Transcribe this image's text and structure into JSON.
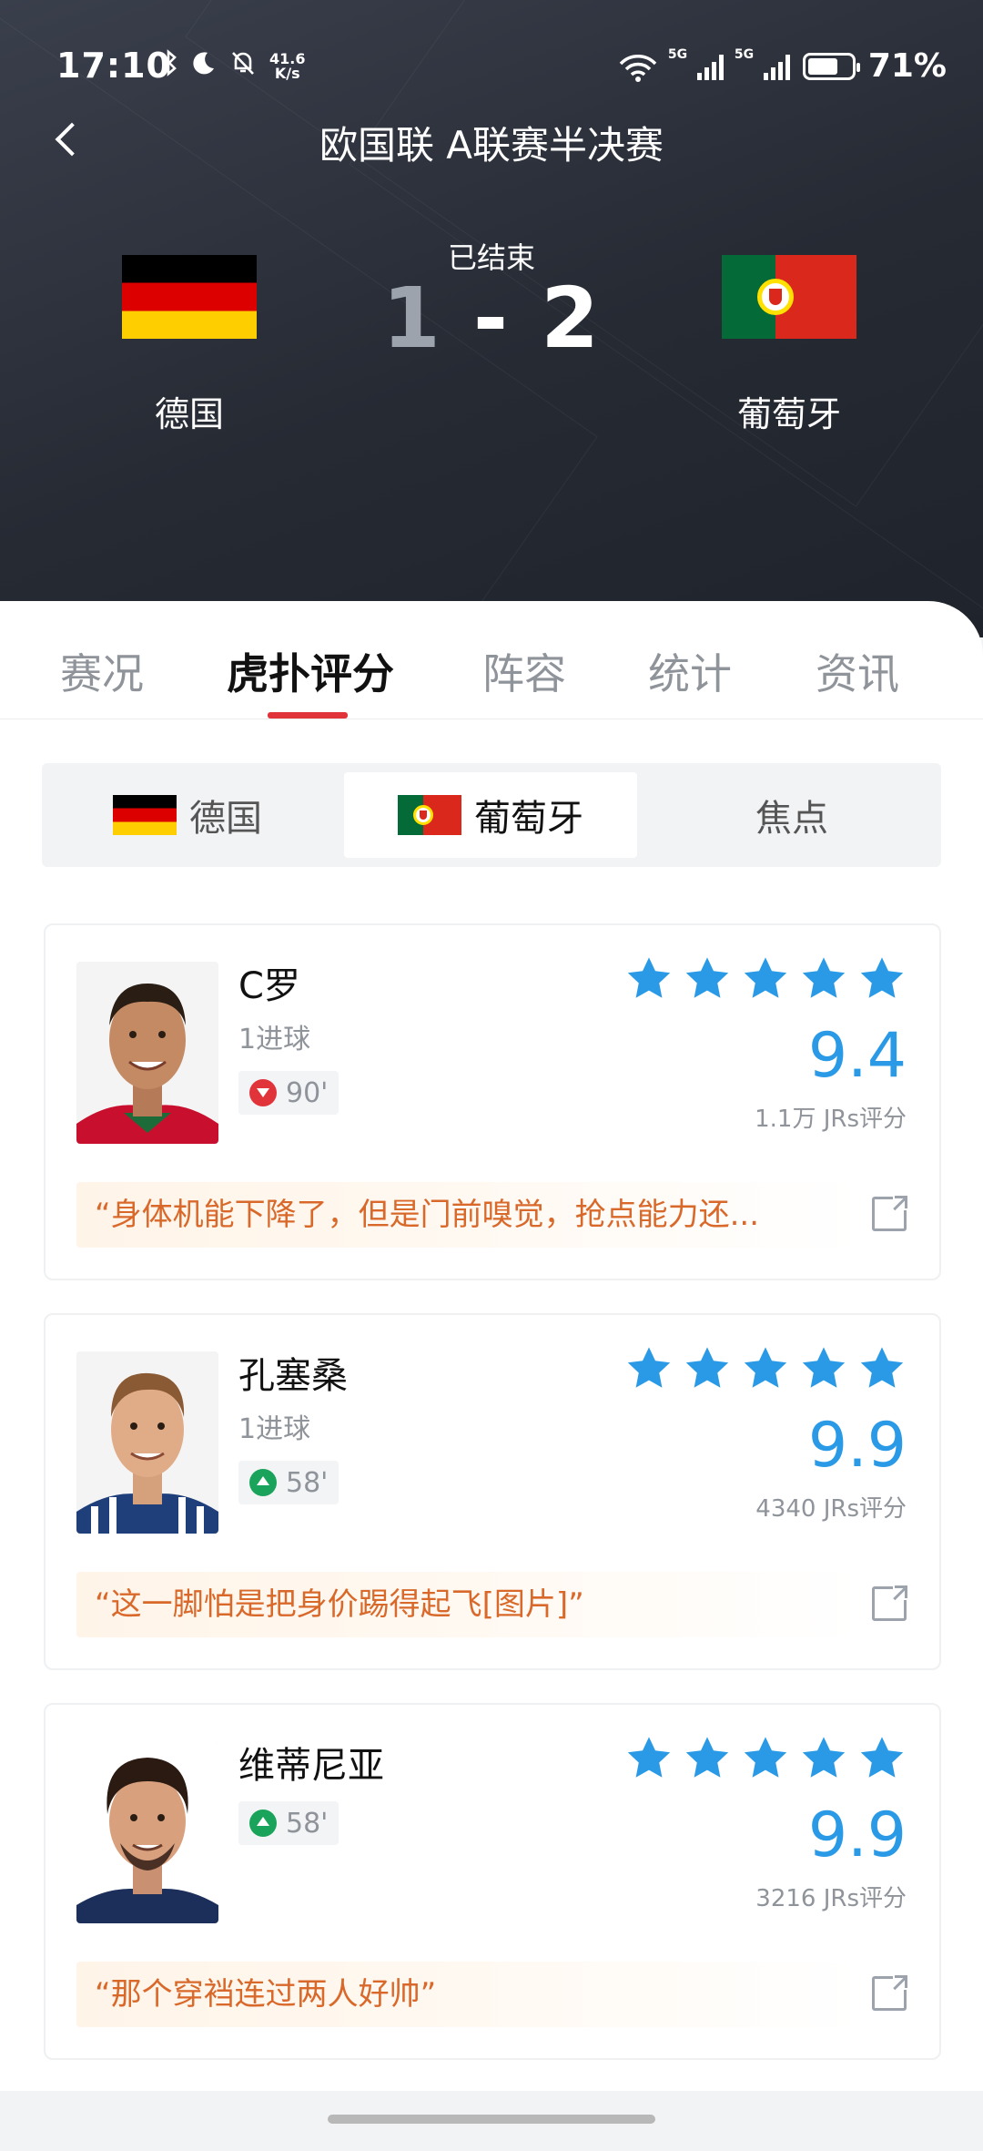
{
  "status_bar": {
    "time": "17:10",
    "net_speed_value": "41.6",
    "net_speed_unit": "K/s",
    "signal1_label": "5G",
    "signal2_label": "5G",
    "battery_pct": "71%",
    "battery_level": 0.71
  },
  "header": {
    "title": "欧国联 A联赛半决赛",
    "status": "已结束",
    "home_score": "1",
    "separator": "-",
    "away_score": "2",
    "home_team": "德国",
    "away_team": "葡萄牙"
  },
  "tabs": [
    {
      "label": "赛况"
    },
    {
      "label": "虎扑评分",
      "active": true
    },
    {
      "label": "阵容"
    },
    {
      "label": "统计"
    },
    {
      "label": "资讯"
    }
  ],
  "segment": [
    {
      "label": "德国",
      "flag": "germany"
    },
    {
      "label": "葡萄牙",
      "flag": "portugal",
      "active": true
    },
    {
      "label": "焦点"
    }
  ],
  "players": [
    {
      "name": "C罗",
      "note": "1进球",
      "sub_type": "off",
      "sub_minute": "90'",
      "stars": 5,
      "rating": "9.4",
      "rating_count": "1.1万 JRs评分",
      "comment": "“身体机能下降了，但是门前嗅觉，抢点能力还..."
    },
    {
      "name": "孔塞桑",
      "note": "1进球",
      "sub_type": "on",
      "sub_minute": "58'",
      "stars": 5,
      "rating": "9.9",
      "rating_count": "4340 JRs评分",
      "comment": "“这一脚怕是把身价踢得起飞[图片]”"
    },
    {
      "name": "维蒂尼亚",
      "note": "",
      "sub_type": "on",
      "sub_minute": "58'",
      "stars": 5,
      "rating": "9.9",
      "rating_count": "3216 JRs评分",
      "comment": "“那个穿裆连过两人好帅”"
    }
  ],
  "colors": {
    "accent_red": "#e0343a",
    "rating_blue": "#2b9ae6",
    "comment_orange": "#d9692b",
    "sub_on_green": "#1aa35a"
  }
}
